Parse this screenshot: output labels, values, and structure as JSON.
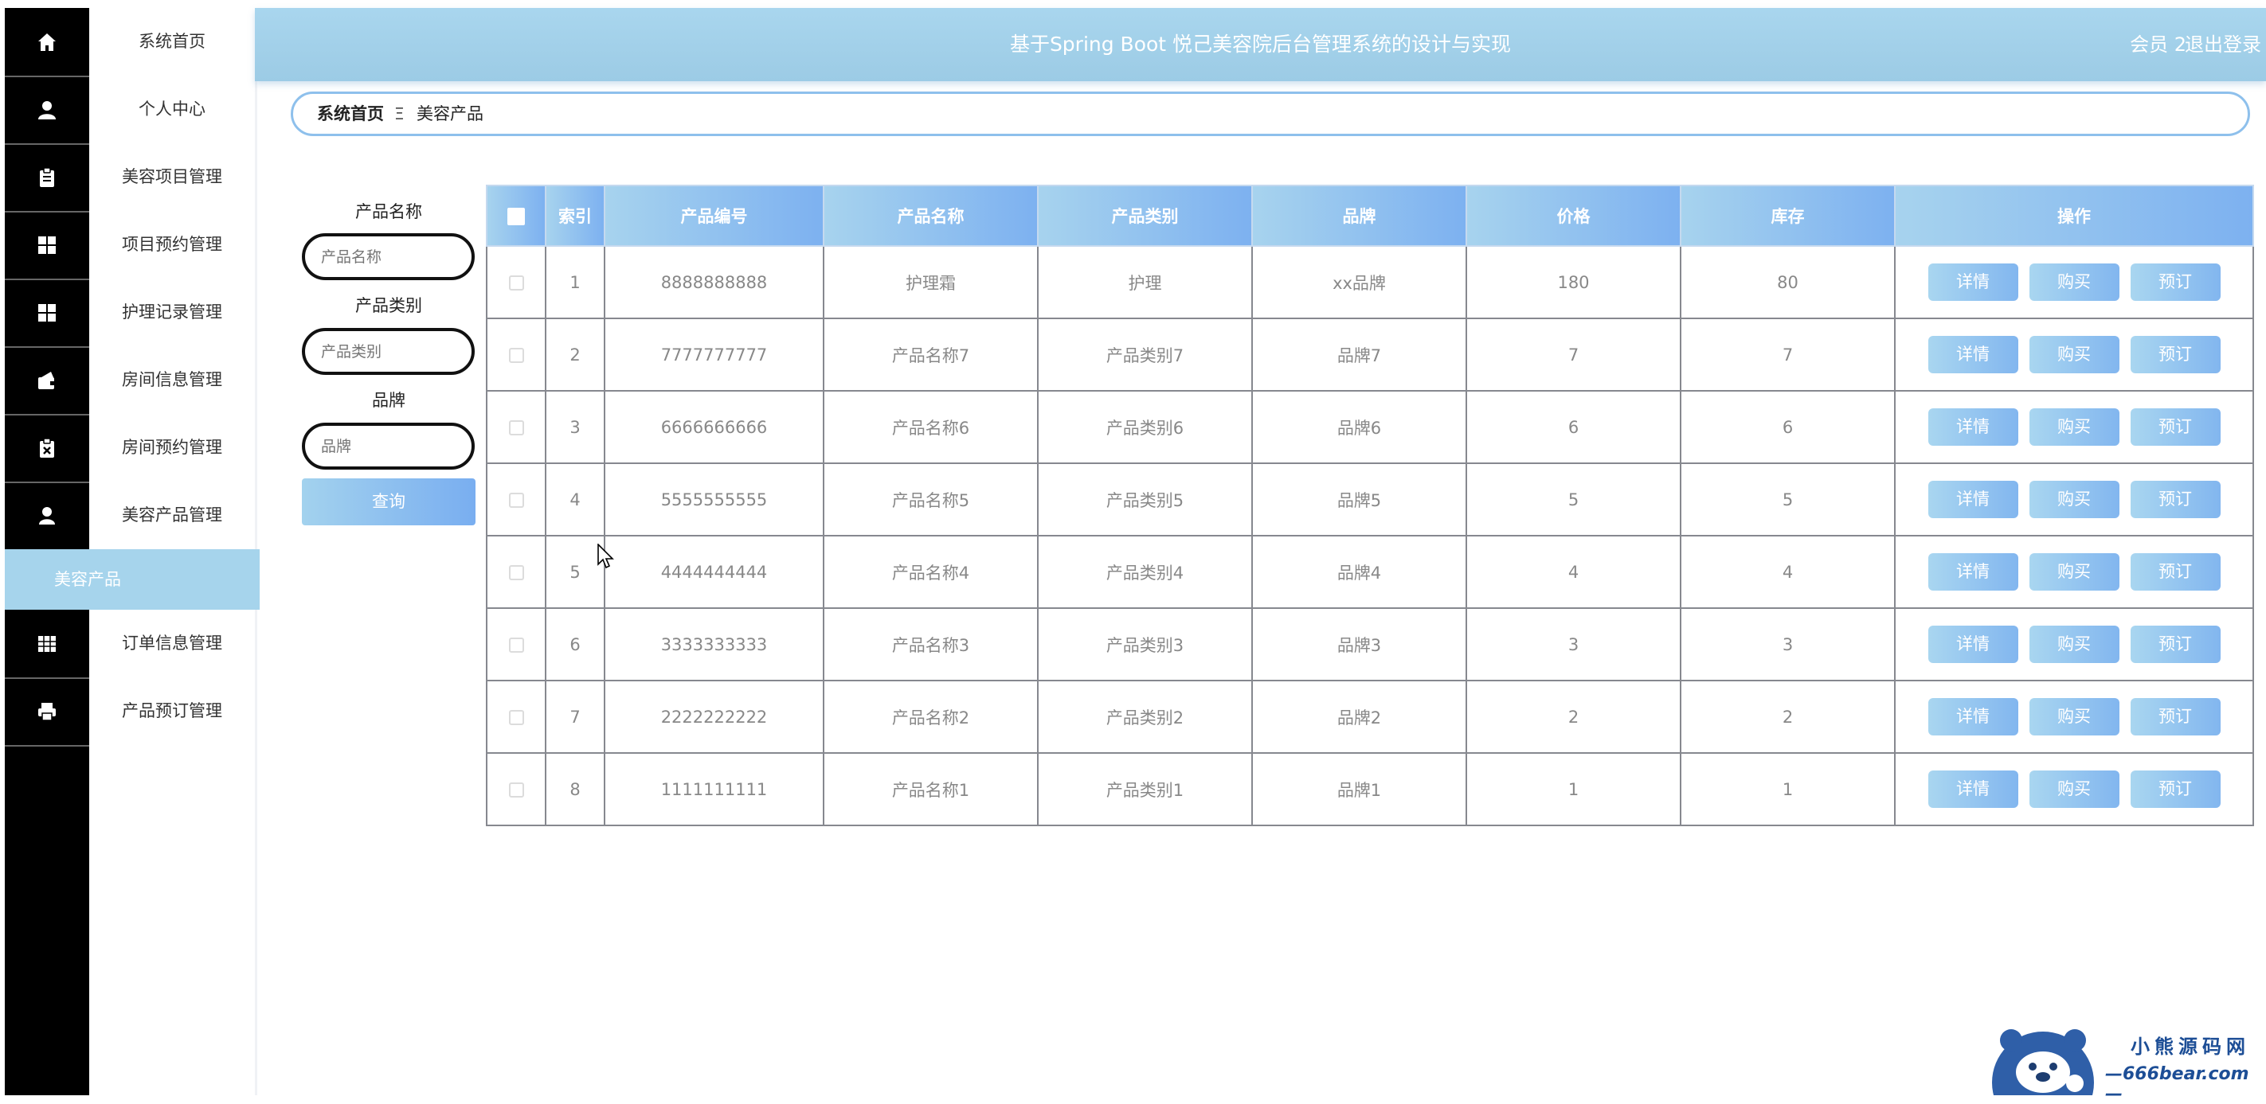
{
  "header": {
    "title": "基于Spring Boot 悦己美容院后台管理系统的设计与实现",
    "user": "会员 2",
    "logout": "退出登录"
  },
  "sidebar": {
    "items": [
      {
        "label": "系统首页",
        "icon": "home-icon"
      },
      {
        "label": "个人中心",
        "icon": "user-icon"
      },
      {
        "label": "美容项目管理",
        "icon": "clipboard-icon"
      },
      {
        "label": "项目预约管理",
        "icon": "grid-icon"
      },
      {
        "label": "护理记录管理",
        "icon": "grid-icon"
      },
      {
        "label": "房间信息管理",
        "icon": "wallet-icon"
      },
      {
        "label": "房间预约管理",
        "icon": "clipboard-x-icon"
      },
      {
        "label": "美容产品管理",
        "icon": "person-icon"
      },
      {
        "label": "美容产品",
        "active": true
      },
      {
        "label": "订单信息管理",
        "icon": "table-icon"
      },
      {
        "label": "产品预订管理",
        "icon": "printer-icon"
      }
    ]
  },
  "breadcrumb": {
    "home": "系统首页",
    "separator": "Ξ",
    "current": "美容产品"
  },
  "search": {
    "fields": [
      {
        "label": "产品名称",
        "placeholder": "产品名称"
      },
      {
        "label": "产品类别",
        "placeholder": "产品类别"
      },
      {
        "label": "品牌",
        "placeholder": "品牌"
      }
    ],
    "query_label": "查询"
  },
  "table": {
    "columns": [
      "索引",
      "产品编号",
      "产品名称",
      "产品类别",
      "品牌",
      "价格",
      "库存",
      "操作"
    ],
    "rows": [
      {
        "index": "1",
        "code": "8888888888",
        "name": "护理霜",
        "category": "护理",
        "brand": "xx品牌",
        "price": "180",
        "stock": "80"
      },
      {
        "index": "2",
        "code": "7777777777",
        "name": "产品名称7",
        "category": "产品类别7",
        "brand": "品牌7",
        "price": "7",
        "stock": "7"
      },
      {
        "index": "3",
        "code": "6666666666",
        "name": "产品名称6",
        "category": "产品类别6",
        "brand": "品牌6",
        "price": "6",
        "stock": "6"
      },
      {
        "index": "4",
        "code": "5555555555",
        "name": "产品名称5",
        "category": "产品类别5",
        "brand": "品牌5",
        "price": "5",
        "stock": "5"
      },
      {
        "index": "5",
        "code": "4444444444",
        "name": "产品名称4",
        "category": "产品类别4",
        "brand": "品牌4",
        "price": "4",
        "stock": "4"
      },
      {
        "index": "6",
        "code": "3333333333",
        "name": "产品名称3",
        "category": "产品类别3",
        "brand": "品牌3",
        "price": "3",
        "stock": "3"
      },
      {
        "index": "7",
        "code": "2222222222",
        "name": "产品名称2",
        "category": "产品类别2",
        "brand": "品牌2",
        "price": "2",
        "stock": "2"
      },
      {
        "index": "8",
        "code": "1111111111",
        "name": "产品名称1",
        "category": "产品类别1",
        "brand": "品牌1",
        "price": "1",
        "stock": "1"
      }
    ],
    "actions": [
      "详情",
      "购买",
      "预订"
    ]
  },
  "watermark": {
    "line1": "小熊源码网",
    "line2": "—666bear.com—"
  },
  "colors": {
    "header": "#a6d4ec",
    "accent_start": "#a7d3ee",
    "accent_end": "#7db1f0",
    "rail": "#000000"
  }
}
